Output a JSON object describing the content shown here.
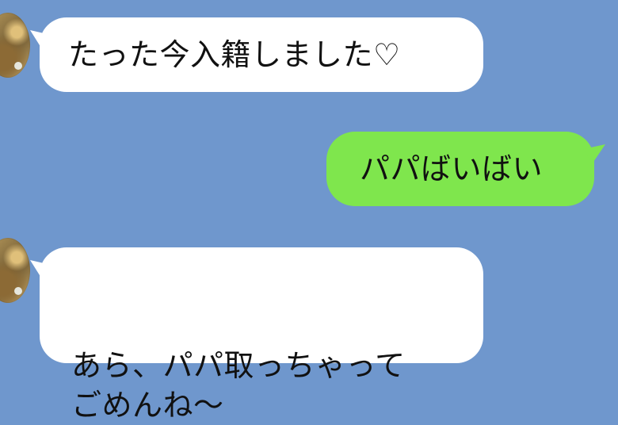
{
  "chat": {
    "messages": [
      {
        "sender": "incoming",
        "text": "たった今入籍しました♡"
      },
      {
        "sender": "outgoing",
        "text": "パパばいばい"
      },
      {
        "sender": "incoming",
        "text": "あら、パパ取っちゃって\nごめんね〜"
      }
    ]
  },
  "colors": {
    "background": "#6f97cd",
    "incoming_bubble": "#ffffff",
    "outgoing_bubble": "#7fe64d",
    "text": "#111111"
  }
}
